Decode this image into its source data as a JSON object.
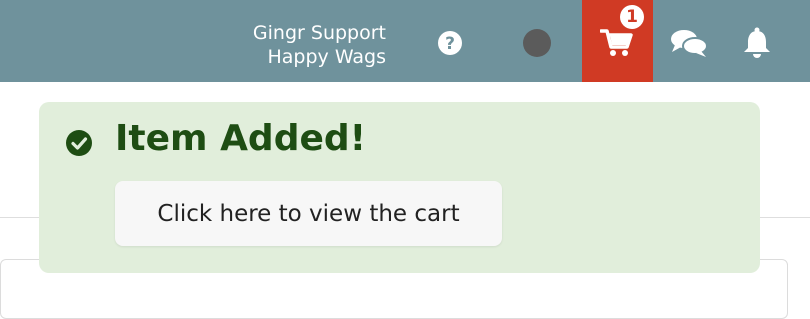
{
  "header": {
    "account_name": "Gingr Support",
    "location_name": "Happy Wags",
    "help_icon": "question-circle-icon",
    "status_icon": "status-dot",
    "cart": {
      "icon": "cart-icon",
      "count": "1",
      "background": "#d03a24"
    },
    "chat_icon": "chat-bubbles-icon",
    "bell_icon": "bell-icon",
    "bar_color": "#6f929c"
  },
  "toast": {
    "icon": "check-circle-icon",
    "title": "Item Added!",
    "button_label": "Click here to view the cart",
    "background": "#e1eedb",
    "title_color": "#1e4d13"
  }
}
